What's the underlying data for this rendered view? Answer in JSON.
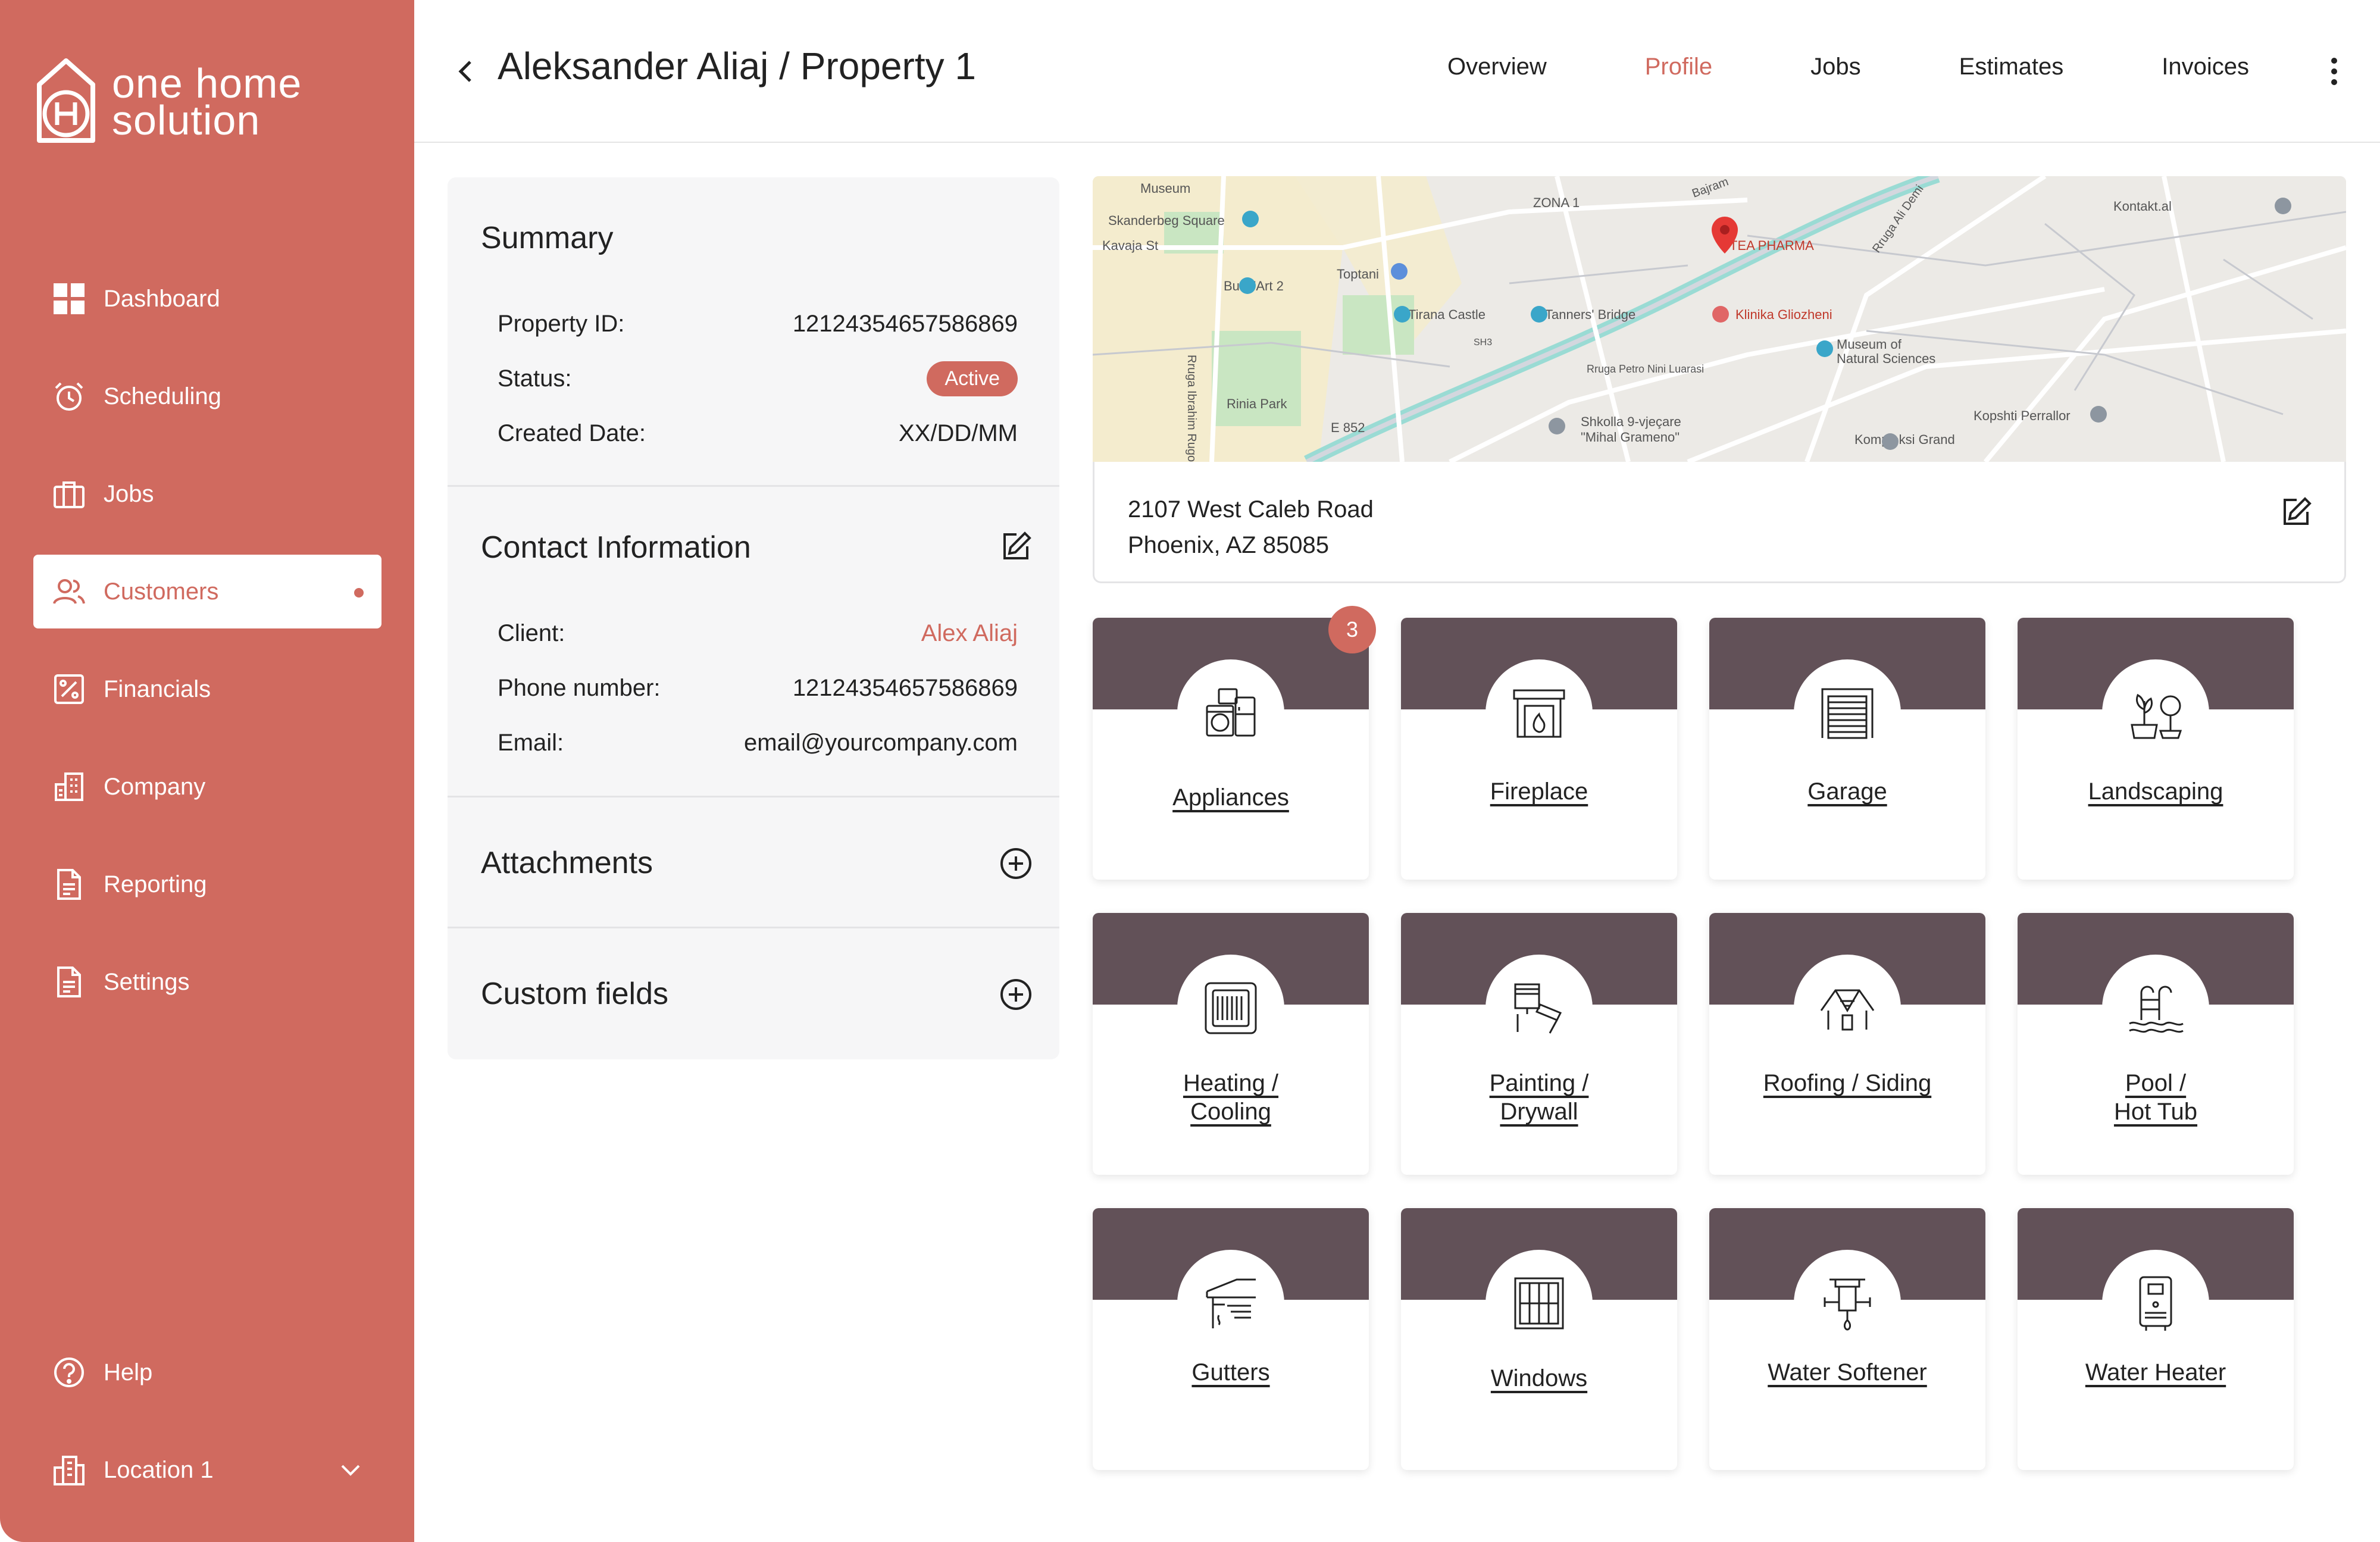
{
  "brand": {
    "name_line1": "one home",
    "name_line2": "solution",
    "accent": "#d06a5f",
    "band": "#625158"
  },
  "sidebar": {
    "items": [
      {
        "label": "Dashboard",
        "icon": "dashboard-icon"
      },
      {
        "label": "Scheduling",
        "icon": "alarm-clock-icon"
      },
      {
        "label": "Jobs",
        "icon": "briefcase-icon"
      },
      {
        "label": "Customers",
        "icon": "users-icon",
        "active": true
      },
      {
        "label": "Financials",
        "icon": "percent-icon"
      },
      {
        "label": "Company",
        "icon": "building-icon"
      },
      {
        "label": "Reporting",
        "icon": "document-icon"
      },
      {
        "label": "Settings",
        "icon": "document-icon"
      }
    ],
    "help": "Help",
    "location": "Location 1"
  },
  "header": {
    "title": "Aleksander Aliaj / Property 1",
    "tabs": [
      {
        "label": "Overview"
      },
      {
        "label": "Profile",
        "active": true
      },
      {
        "label": "Jobs"
      },
      {
        "label": "Estimates"
      },
      {
        "label": "Invoices"
      }
    ]
  },
  "summary": {
    "title": "Summary",
    "property_id_label": "Property ID:",
    "property_id": "12124354657586869",
    "status_label": "Status:",
    "status": "Active",
    "created_label": "Created Date:",
    "created": "XX/DD/MM"
  },
  "contact": {
    "title": "Contact Information",
    "client_label": "Client:",
    "client": "Alex Aliaj",
    "phone_label": "Phone number:",
    "phone": "12124354657586869",
    "email_label": "Email:",
    "email": "email@yourcompany.com"
  },
  "attachments": {
    "title": "Attachments"
  },
  "custom_fields": {
    "title": "Custom fields"
  },
  "map": {
    "labels": [
      "Museum",
      "Skanderbeg Square",
      "Kavaja St",
      "ZONA 1",
      "Toptani",
      "Bunk'Art 2",
      "Tirana Castle",
      "Tanners' Bridge",
      "TEA PHARMA",
      "Klinika Gliozheni",
      "Museum of",
      "Natural Sciences",
      "Rruga Petro Nini Luarasi",
      "Rinia Park",
      "E 852",
      "Shkolla 9-vjeçare",
      "\"Mihal Grameno\"",
      "Kopshti Perrallor",
      "Kompleksi Grand",
      "Kontakt.al",
      "Rruga Ibrahim Rugova",
      "Rruga Ali Demi",
      "SH3",
      "Bajram"
    ]
  },
  "address": {
    "line1": "2107 West Caleb Road",
    "line2": "Phoenix, AZ 85085"
  },
  "categories": [
    {
      "label": "Appliances",
      "icon": "appliances-icon",
      "badge": "3"
    },
    {
      "label": "Fireplace",
      "icon": "fireplace-icon"
    },
    {
      "label": "Garage",
      "icon": "garage-icon"
    },
    {
      "label": "Landscaping",
      "icon": "landscaping-icon"
    },
    {
      "label": "Heating /",
      "label2": "Cooling",
      "icon": "hvac-icon"
    },
    {
      "label": "Painting /",
      "label2": "Drywall",
      "icon": "painting-icon"
    },
    {
      "label": "Roofing / Siding",
      "icon": "roofing-icon"
    },
    {
      "label": "Pool /",
      "label2": "Hot Tub",
      "icon": "pool-icon"
    },
    {
      "label": "Gutters",
      "icon": "gutters-icon"
    },
    {
      "label": "Windows",
      "icon": "windows-icon"
    },
    {
      "label": "Water Softener",
      "icon": "water-softener-icon"
    },
    {
      "label": "Water Heater",
      "icon": "water-heater-icon"
    }
  ]
}
